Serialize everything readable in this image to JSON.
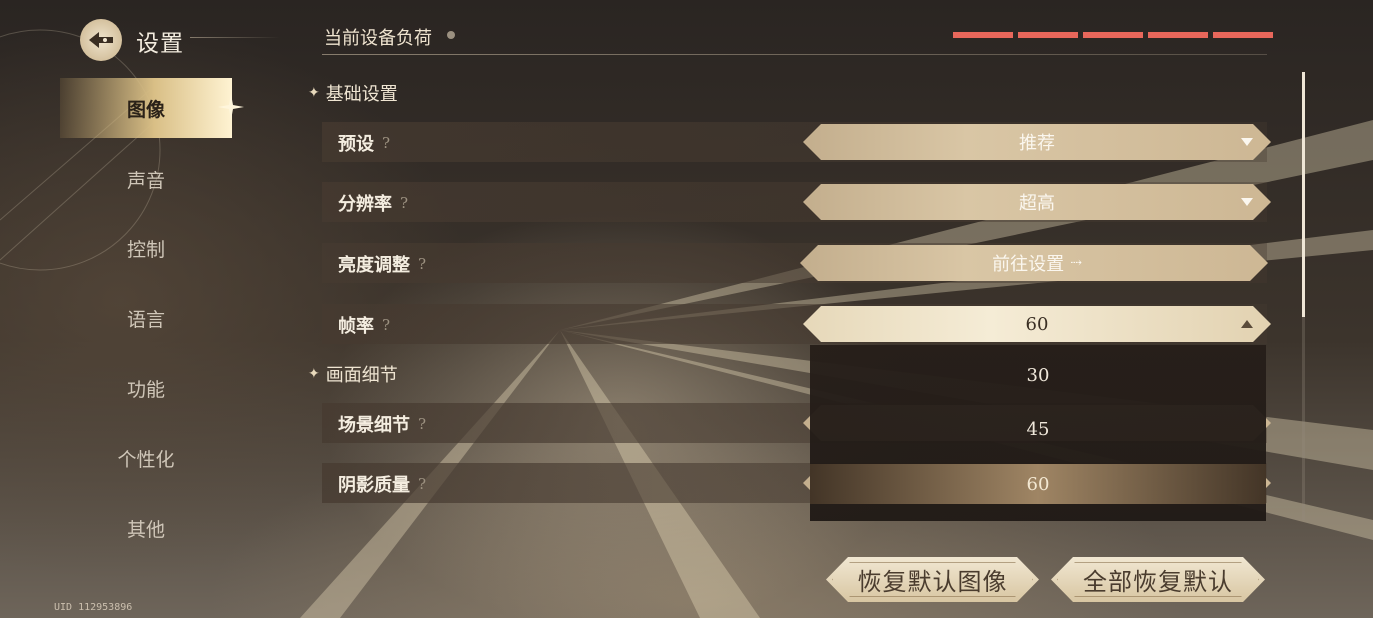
{
  "header": {
    "title": "设置",
    "device_load_label": "当前设备负荷",
    "load_level": 5,
    "load_max": 5,
    "load_color": "#e8675b"
  },
  "sidebar": {
    "items": [
      {
        "label": "图像",
        "active": true
      },
      {
        "label": "声音",
        "active": false
      },
      {
        "label": "控制",
        "active": false
      },
      {
        "label": "语言",
        "active": false
      },
      {
        "label": "功能",
        "active": false
      },
      {
        "label": "个性化",
        "active": false
      },
      {
        "label": "其他",
        "active": false
      }
    ],
    "uid": "UID 112953896"
  },
  "sections": {
    "basic": "基础设置",
    "detail": "画面细节"
  },
  "settings": {
    "preset": {
      "label": "预设",
      "value": "推荐"
    },
    "resolution": {
      "label": "分辨率",
      "value": "超高"
    },
    "brightness": {
      "label": "亮度调整",
      "value": "前往设置"
    },
    "framerate": {
      "label": "帧率",
      "value": "60"
    },
    "scene_detail": {
      "label": "场景细节"
    },
    "shadow_quality": {
      "label": "阴影质量"
    },
    "help_glyph": "?"
  },
  "framerate_menu": {
    "options": [
      "30",
      "45",
      "60"
    ],
    "selected": "60"
  },
  "footer": {
    "reset_graphics": "恢复默认图像",
    "reset_all": "全部恢复默认"
  },
  "icons": {
    "back": "back-arrow-icon",
    "dropdown": "chevron-down-icon",
    "dropdown_open": "chevron-up-icon",
    "go": "arrow-right-icon",
    "section": "sparkle-icon"
  }
}
